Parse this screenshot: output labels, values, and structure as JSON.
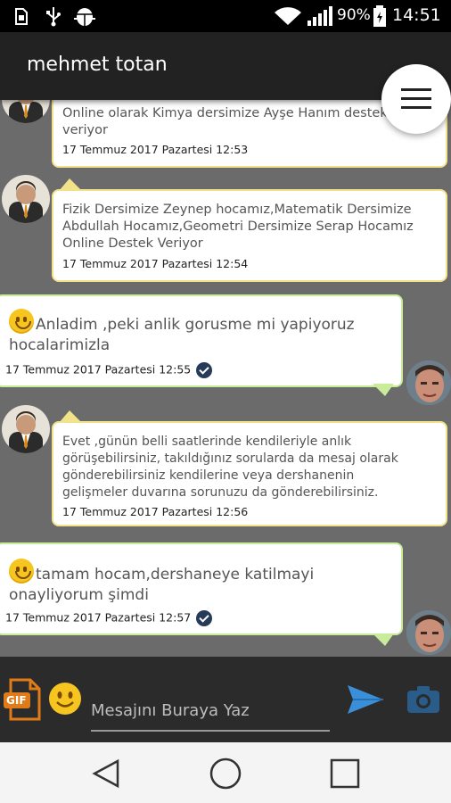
{
  "status_bar": {
    "battery_percent": "90%",
    "time": "14:51",
    "icons": [
      "sim-icon",
      "usb-icon",
      "android-debug-icon",
      "wifi-icon",
      "signal-icon",
      "battery-icon"
    ]
  },
  "toolbar": {
    "title": "mehmet totan",
    "menu_icon": "hamburger-menu-icon"
  },
  "messages": [
    {
      "direction": "in",
      "lines": [
        "Online olarak Kimya dersimize Ayşe Hanım destek",
        "veriyor"
      ],
      "timestamp": "17 Temmuz 2017 Pazartesi 12:53"
    },
    {
      "direction": "in",
      "lines": [
        "Fizik Dersimize Zeynep hocamız,Matematik Dersimize",
        "Abdullah Hocamız,Geometri Dersimize Serap Hocamız",
        "Online Destek Veriyor"
      ],
      "timestamp": "17 Temmuz 2017 Pazartesi 12:54"
    },
    {
      "direction": "out",
      "lines": [
        "Anladim ,peki anlik gorusme mi yapiyoruz",
        "hocalarimizla"
      ],
      "timestamp": "17 Temmuz 2017 Pazartesi 12:55",
      "emoji": "smiling-face-icon",
      "read": true
    },
    {
      "direction": "in",
      "lines": [
        "Evet ,günün belli saatlerinde kendileriyle anlık",
        "görüşebilirsiniz, takıldığınız sorularda da mesaj olarak",
        "gönderebilirsiniz kendilerine veya dershanenin",
        "gelişmeler duvarına sorunuzu da gönderebilirsiniz."
      ],
      "timestamp": "17 Temmuz 2017 Pazartesi 12:56"
    },
    {
      "direction": "out",
      "lines": [
        "tamam hocam,dershaneye katilmayi",
        "onayliyorum şimdi"
      ],
      "timestamp": "17 Temmuz 2017 Pazartesi 12:57",
      "emoji": "smiling-face-icon",
      "read": true
    }
  ],
  "input_bar": {
    "placeholder": "Mesajını Buraya Yaz",
    "gif_label": "GIF",
    "icons": [
      "gif-icon",
      "emoji-icon",
      "send-icon",
      "camera-icon"
    ]
  },
  "nav_bar": {
    "icons": [
      "back-icon",
      "home-icon",
      "recents-icon"
    ]
  },
  "colors": {
    "chat_background": "#6b6b6b",
    "incoming_border": "#f2e28a",
    "outgoing_border": "#c8ec9a",
    "send_accent": "#3a8fd8",
    "read_check": "#263a5a"
  }
}
